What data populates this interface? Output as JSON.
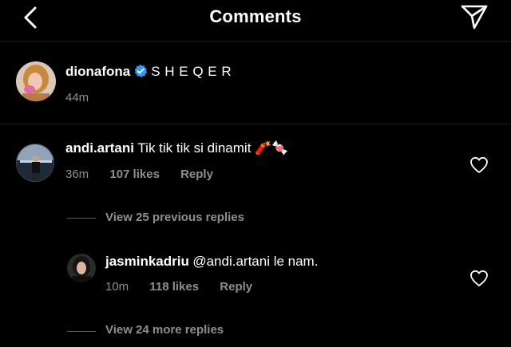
{
  "header": {
    "title": "Comments",
    "back_icon": "chevron-left-icon",
    "send_icon": "send-icon"
  },
  "caption": {
    "username": "dionafona",
    "verified": true,
    "text": "S H E Q E R",
    "time": "44m"
  },
  "comments": [
    {
      "username": "andi.artani",
      "text": "Tik tik tik si dinamit 🧨🍬",
      "time": "36m",
      "likes": "107 likes",
      "reply_label": "Reply"
    }
  ],
  "view_previous": "View 25 previous replies",
  "reply": {
    "username": "jasminkadriu",
    "text": "@andi.artani le nam.",
    "time": "10m",
    "likes": "118 likes",
    "reply_label": "Reply"
  },
  "view_more": "View 24 more replies",
  "colors": {
    "background": "#000000",
    "text": "#ffffff",
    "secondary": "#8e8e8e",
    "verified": "#3897f0"
  }
}
